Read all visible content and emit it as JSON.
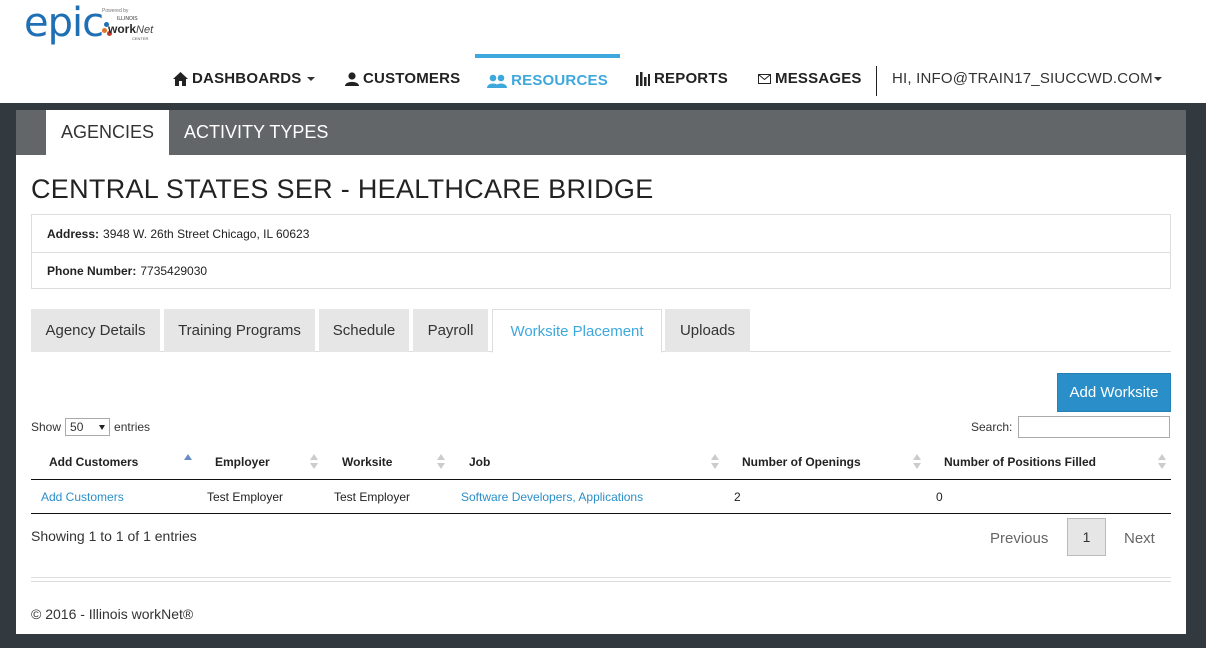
{
  "logo": {
    "brand": "epic",
    "powered_by": "Powered by",
    "illinois": "ILLINOIS",
    "worknet": "work",
    "worknet_suffix": "Net",
    "center": "CENTER"
  },
  "nav": {
    "dashboards": "DASHBOARDS",
    "customers": "CUSTOMERS",
    "resources": "RESOURCES",
    "reports": "REPORTS",
    "messages": "MESSAGES",
    "user": "HI, INFO@TRAIN17_SIUCCWD.COM",
    "active": "RESOURCES",
    "accent_color": "#3ea8dc"
  },
  "subnav": {
    "agencies": "AGENCIES",
    "activity_types": "ACTIVITY TYPES"
  },
  "agency": {
    "title": "CENTRAL STATES SER - HEALTHCARE BRIDGE",
    "address_label": "Address:",
    "address": "3948 W. 26th Street Chicago, IL 60623",
    "phone_label": "Phone Number:",
    "phone": "7735429030"
  },
  "tabs": {
    "agency_details": "Agency Details",
    "training_programs": "Training Programs",
    "schedule": "Schedule",
    "payroll": "Payroll",
    "worksite_placement": "Worksite Placement",
    "uploads": "Uploads",
    "active": "Worksite Placement"
  },
  "actions": {
    "add_worksite": "Add Worksite"
  },
  "table_controls": {
    "show": "Show",
    "page_size": "50",
    "entries": "entries",
    "search_label": "Search:",
    "search_value": ""
  },
  "table": {
    "columns": [
      "Add Customers",
      "Employer",
      "Worksite",
      "Job",
      "Number of Openings",
      "Number of Positions Filled"
    ],
    "rows": [
      {
        "add_customers": "Add Customers",
        "employer": "Test Employer",
        "worksite": "Test Employer",
        "job": "Software Developers, Applications",
        "openings": "2",
        "filled": "0"
      }
    ]
  },
  "pagination": {
    "summary": "Showing 1 to 1 of 1 entries",
    "previous": "Previous",
    "current_page": "1",
    "next": "Next"
  },
  "footer": {
    "copyright": "© 2016 - Illinois workNet®"
  }
}
